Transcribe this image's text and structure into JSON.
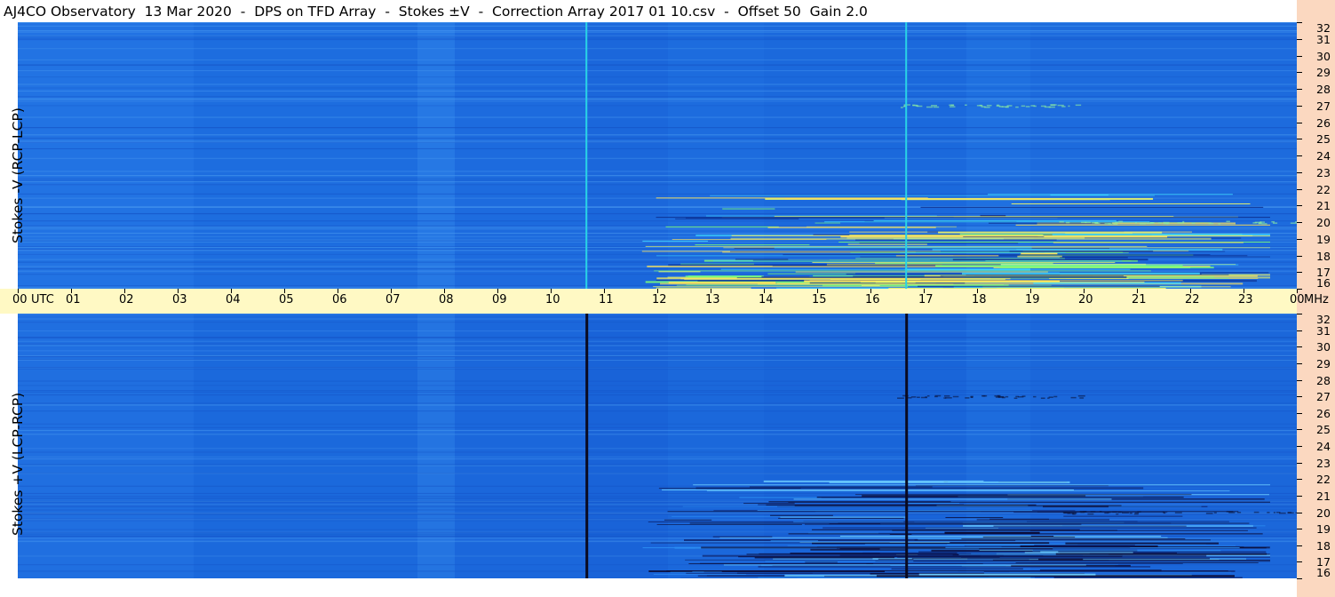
{
  "title": "AJ4CO Observatory  13 Mar 2020  -  DPS on TFD Array  -  Stokes ±V  -  Correction Array 2017 01 10.csv  -  Offset 50  Gain 2.0",
  "colors": {
    "background_blue": "#1e6fe0",
    "time_axis_bg": "#fff9c4",
    "freq_axis_bg": "#fbd8c0",
    "cyan_line": "#29d3e6",
    "dark_line": "#0a0a20"
  },
  "chart_data": [
    {
      "type": "heatmap",
      "ylabel": "Stokes -V (RCP-LCP)",
      "xlabel": "UTC",
      "x_unit": "UTC hours",
      "y_unit": "MHz",
      "xlim": [
        0,
        24
      ],
      "ylim": [
        16,
        32
      ],
      "x_tick_labels": [
        "00",
        "01",
        "02",
        "03",
        "04",
        "05",
        "06",
        "07",
        "08",
        "09",
        "10",
        "11",
        "12",
        "13",
        "14",
        "15",
        "16",
        "17",
        "18",
        "19",
        "20",
        "21",
        "22",
        "23",
        "00"
      ],
      "y_tick_labels": [
        "32",
        "31",
        "30",
        "29",
        "28",
        "27",
        "26",
        "25",
        "24",
        "23",
        "22",
        "21",
        "20",
        "19",
        "18",
        "17",
        "16"
      ],
      "vertical_lines": [
        {
          "utc": 10.67,
          "color": "#29d3e6"
        },
        {
          "utc": 16.67,
          "color": "#29d3e6"
        }
      ],
      "activity_region": {
        "utc_start": 11.7,
        "utc_end": 23.5,
        "mhz_start": 16,
        "mhz_end": 22
      }
    },
    {
      "type": "heatmap",
      "ylabel": "Stokes +V (LCP-RCP)",
      "xlabel": "UTC",
      "x_unit": "UTC hours",
      "y_unit": "MHz",
      "xlim": [
        0,
        24
      ],
      "ylim": [
        16,
        32
      ],
      "x_tick_labels": [
        "00",
        "01",
        "02",
        "03",
        "04",
        "05",
        "06",
        "07",
        "08",
        "09",
        "10",
        "11",
        "12",
        "13",
        "14",
        "15",
        "16",
        "17",
        "18",
        "19",
        "20",
        "21",
        "22",
        "23",
        "00"
      ],
      "y_tick_labels": [
        "32",
        "31",
        "30",
        "29",
        "28",
        "27",
        "26",
        "25",
        "24",
        "23",
        "22",
        "21",
        "20",
        "19",
        "18",
        "17",
        "16"
      ],
      "vertical_lines": [
        {
          "utc": 10.67,
          "color": "#0a0a20"
        },
        {
          "utc": 16.67,
          "color": "#0a0a20"
        }
      ],
      "activity_region": {
        "utc_start": 11.7,
        "utc_end": 23.5,
        "mhz_start": 16,
        "mhz_end": 22
      }
    }
  ],
  "axis": {
    "time_unit_label": "UTC",
    "freq_unit_label": "MHz"
  }
}
